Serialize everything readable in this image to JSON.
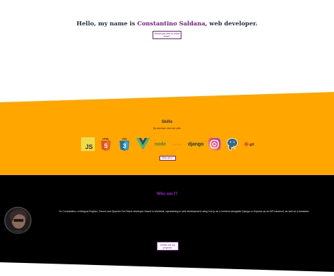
{
  "hero": {
    "greeting": "Hello, my name is ",
    "name": "Constantino Saldana",
    "suffix": ", web developer.",
    "button_line1": "Would you like to know",
    "button_line2": "more?"
  },
  "skills": {
    "title": "Skills",
    "subtitle": "My developer and tech skills",
    "logos": [
      {
        "icon": "javascript-icon",
        "label": "JS"
      },
      {
        "icon": "html5-icon",
        "label": "HTML"
      },
      {
        "icon": "css3-icon",
        "label": "CSS"
      },
      {
        "icon": "vue-icon",
        "label": ""
      },
      {
        "icon": "nodejs-icon",
        "label": "node"
      },
      {
        "icon": "express-icon",
        "label": "express"
      },
      {
        "icon": "django-icon",
        "label": "django"
      },
      {
        "icon": "instagram-icon",
        "label": ""
      },
      {
        "icon": "postgresql-icon",
        "label": ""
      },
      {
        "icon": "git-icon",
        "label": "git"
      }
    ],
    "button": "Who am I?"
  },
  "about": {
    "title": "Who am I?",
    "bio": "I'm Constantino, a trilingual English, French and Spanish Full Stack developer based in Montréal, specialising in web development using Vue.js as a frontend alongside Django or Express as an API backend, as well as a translator.",
    "button_line1": "Check out my",
    "button_line2": "projects."
  },
  "colors": {
    "accent": "#7a1a8c",
    "skills_bg": "#ffa600",
    "about_bg": "#000000",
    "about_title": "#9a1fd1"
  }
}
